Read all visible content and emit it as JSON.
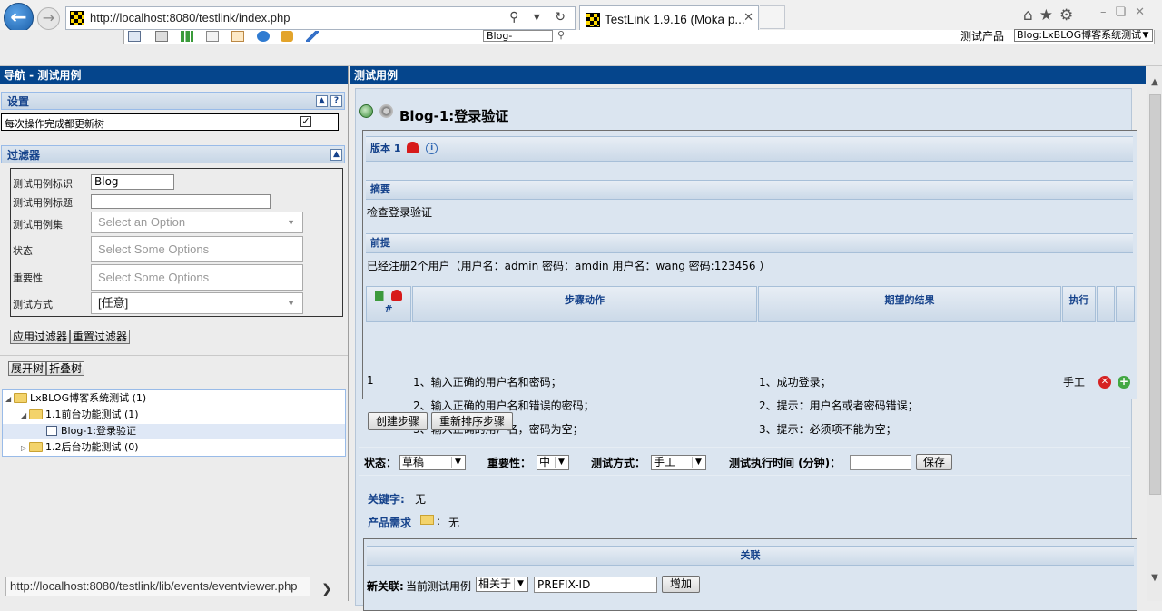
{
  "browser": {
    "url": "http://localhost:8080/testlink/index.php",
    "tab_title": "TestLink 1.9.16 (Moka p...",
    "status_url": "http://localhost:8080/testlink/lib/events/eventviewer.php"
  },
  "toolbar": {
    "search_value": "Blog-",
    "product_label": "测试产品",
    "product_value": "Blog:LxBLOG博客系统测试"
  },
  "nav": {
    "title": "导航 - 测试用例",
    "settings": {
      "title": "设置",
      "update_tree_label": "每次操作完成都更新树"
    },
    "filters": {
      "title": "过滤器",
      "id_label": "测试用例标识",
      "id_value": "Blog-",
      "title_label": "测试用例标题",
      "suite_label": "测试用例集",
      "suite_placeholder": "Select an Option",
      "status_label": "状态",
      "status_placeholder": "Select Some Options",
      "importance_label": "重要性",
      "importance_placeholder": "Select Some Options",
      "exec_type_label": "测试方式",
      "exec_type_value": "[任意]",
      "apply_btn": "应用过滤器",
      "reset_btn": "重置过滤器"
    },
    "expand_btn": "展开树",
    "collapse_btn": "折叠树",
    "tree": [
      {
        "label": "LxBLOG博客系统测试 (1)"
      },
      {
        "label": "1.1前台功能测试 (1)"
      },
      {
        "label": "Blog-1:登录验证"
      },
      {
        "label": "1.2后台功能测试 (0)"
      }
    ]
  },
  "main": {
    "title": "测试用例",
    "testcase_title": "Blog-1:登录验证",
    "version_label": "版本 1",
    "summary_label": "摘要",
    "summary_text": "检查登录验证",
    "precond_label": "前提",
    "precond_text": "已经注册2个用户（用户名：admin 密码：amdin 用户名：wang 密码:123456 ）",
    "steps": {
      "num_header": "#",
      "action_header": "步骤动作",
      "expected_header": "期望的结果",
      "exec_header": "执行",
      "rows": [
        {
          "num": "1",
          "actions": [
            "1、输入正确的用户名和密码；",
            "2、输入正确的用户名和错误的密码；",
            "3、输入正确的用户名，密码为空；"
          ],
          "expected": [
            "1、成功登录；",
            "2、提示：用户名或者密码错误；",
            "3、提示：必须项不能为空；"
          ],
          "exec": "手工"
        }
      ]
    },
    "create_step_btn": "创建步骤",
    "reorder_steps_btn": "重新排序步骤",
    "attrs": {
      "status_label": "状态：",
      "status_value": "草稿",
      "importance_label": "重要性：",
      "importance_value": "中",
      "exec_type_label": "测试方式：",
      "exec_type_value": "手工",
      "duration_label": "测试执行时间 (分钟)：",
      "duration_value": "",
      "save_btn": "保存"
    },
    "keywords_label": "关键字:",
    "keywords_value": "无",
    "requirements_label": "产品需求",
    "requirements_value": "无",
    "relations_title": "关联",
    "new_relation_label": "新关联:",
    "current_case_text": "当前测试用例",
    "relation_type": "相关于",
    "relation_input": "PREFIX-ID",
    "add_btn": "增加"
  }
}
